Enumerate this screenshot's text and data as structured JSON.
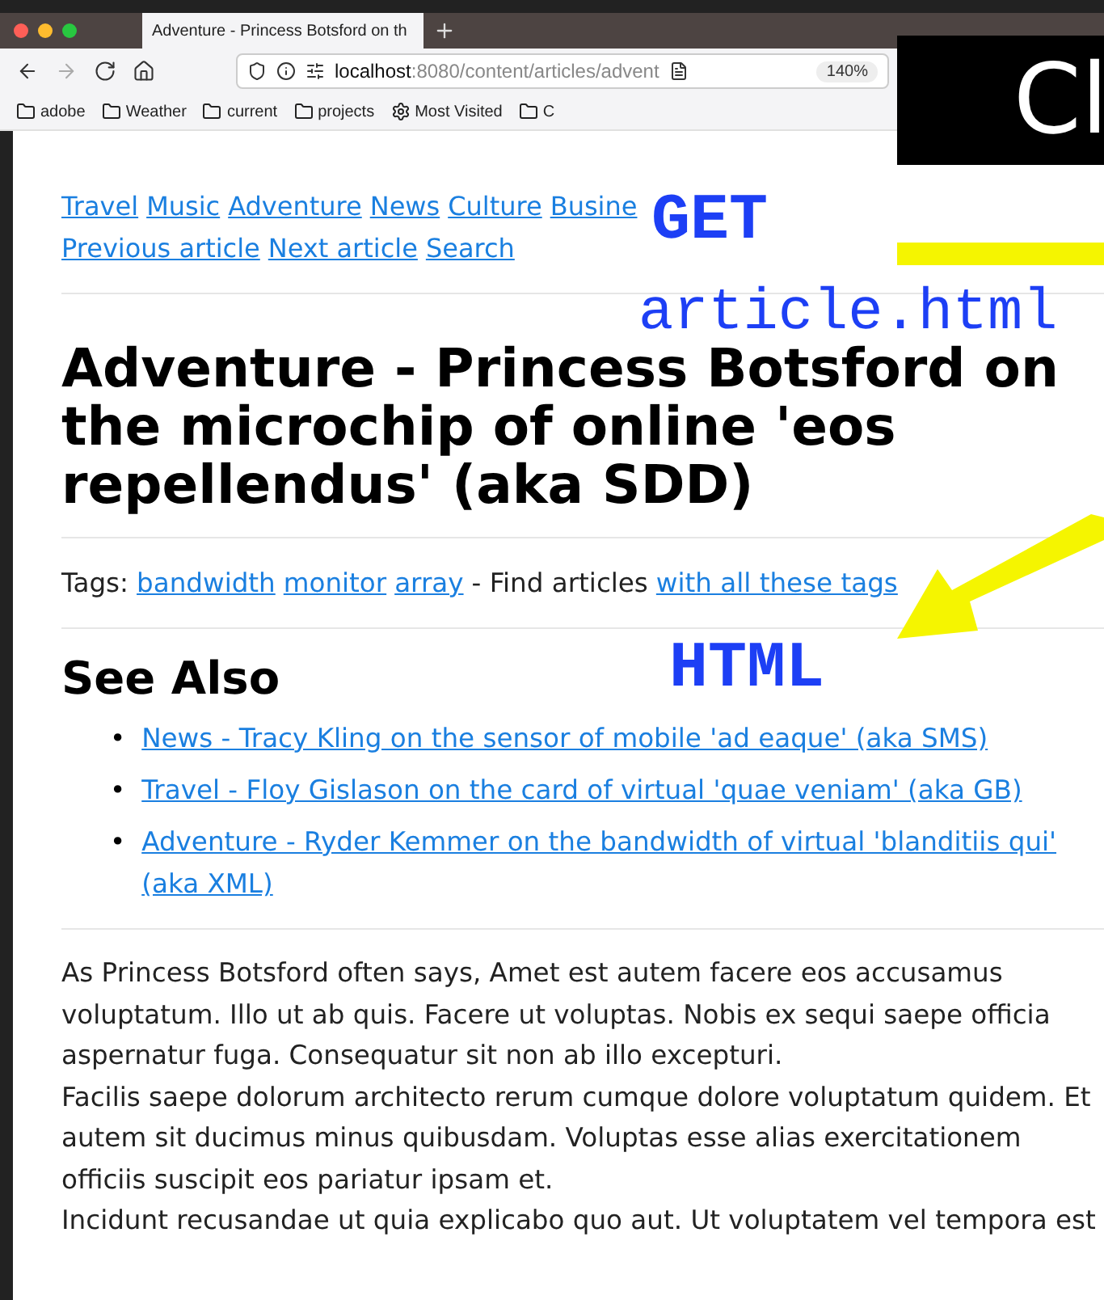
{
  "browser": {
    "tab_title": "Adventure - Princess Botsford on th",
    "url_host": "localhost",
    "url_rest": ":8080/content/articles/advent",
    "zoom": "140%",
    "bookmarks": [
      {
        "label": "adobe",
        "kind": "folder"
      },
      {
        "label": "Weather",
        "kind": "folder"
      },
      {
        "label": "current",
        "kind": "folder"
      },
      {
        "label": "projects",
        "kind": "folder"
      },
      {
        "label": "Most Visited",
        "kind": "gear"
      },
      {
        "label": "C",
        "kind": "folder"
      }
    ]
  },
  "page": {
    "nav_links": [
      "Travel",
      "Music",
      "Adventure",
      "News",
      "Culture",
      "Busine"
    ],
    "nav_links_2": [
      "Previous article",
      "Next article",
      "Search"
    ],
    "title": "Adventure - Princess Botsford on the microchip of online 'eos repellendus' (aka SDD)",
    "tags_label": "Tags:",
    "tags": [
      "bandwidth",
      "monitor",
      "array"
    ],
    "find_text": "- Find articles",
    "find_link": "with all these tags",
    "see_also": "See Also",
    "bullet": "•",
    "see_also_links": [
      "News - Tracy Kling on the sensor of mobile 'ad eaque' (aka SMS)",
      "Travel - Floy Gislason on the card of virtual 'quae veniam' (aka GB)",
      "Adventure - Ryder Kemmer on the bandwidth of virtual 'blanditiis qui' (aka XML)"
    ],
    "paragraphs": [
      "As Princess Botsford often says, Amet est autem facere eos accusamus voluptatum. Illo ut ab quis. Facere ut voluptas. Nobis ex sequi saepe officia aspernatur fuga. Consequatur sit non ab illo excepturi.",
      "Facilis saepe dolorum architecto rerum cumque dolore voluptatum quidem. Et autem sit ducimus minus quibusdam. Voluptas esse alias exercitationem officiis suscipit eos pariatur ipsam et.",
      "Incidunt recusandae ut quia explicabo quo aut. Ut voluptatem vel tempora est"
    ]
  },
  "overlays": {
    "slide_title": "Cl",
    "get": "GET",
    "file": "article.html",
    "html": "HTML"
  }
}
